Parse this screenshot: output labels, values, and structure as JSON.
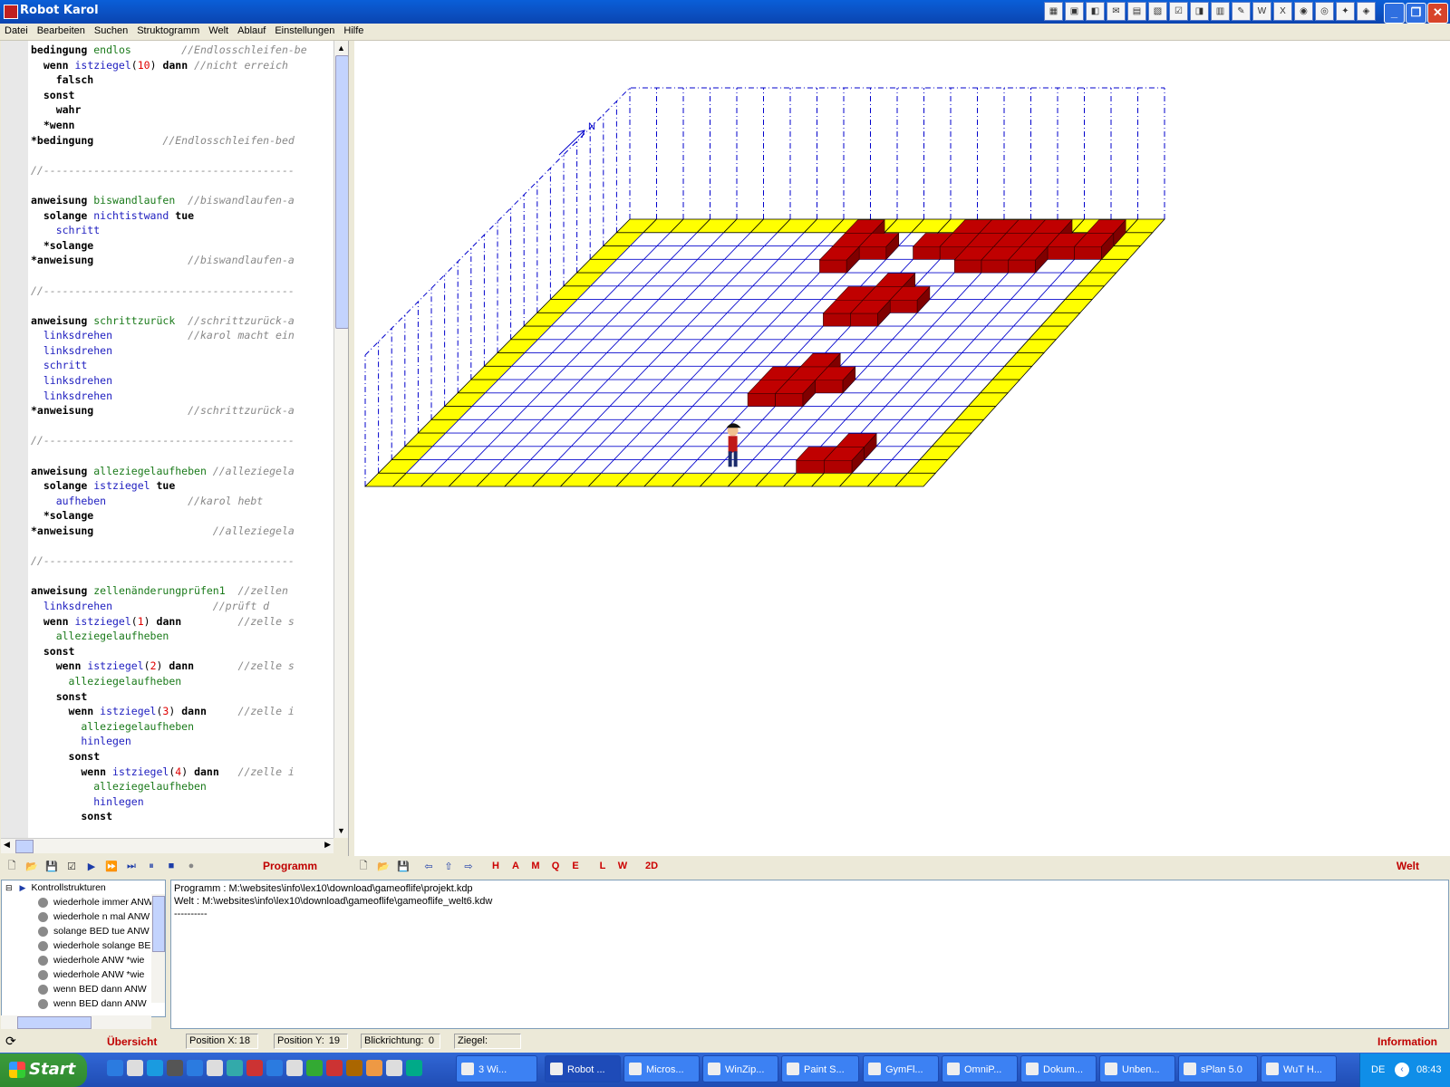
{
  "window": {
    "title": "Robot Karol"
  },
  "menu": [
    "Datei",
    "Bearbeiten",
    "Suchen",
    "Struktogramm",
    "Welt",
    "Ablauf",
    "Einstellungen",
    "Hilfe"
  ],
  "code_lines": [
    [
      {
        "t": "bedingung ",
        "c": "kw"
      },
      {
        "t": "endlos",
        "c": "fn"
      },
      {
        "t": "        //Endlosschleifen-be",
        "c": "cm"
      }
    ],
    [
      {
        "t": "  wenn ",
        "c": "kw"
      },
      {
        "t": "istziegel",
        "c": "bi"
      },
      {
        "t": "(",
        "c": ""
      },
      {
        "t": "10",
        "c": "nm"
      },
      {
        "t": ") ",
        "c": ""
      },
      {
        "t": "dann ",
        "c": "kw"
      },
      {
        "t": "//nicht erreich",
        "c": "cm"
      }
    ],
    [
      {
        "t": "    falsch",
        "c": "kw"
      }
    ],
    [
      {
        "t": "  sonst",
        "c": "kw"
      }
    ],
    [
      {
        "t": "    wahr",
        "c": "kw"
      }
    ],
    [
      {
        "t": "  *wenn",
        "c": "kw"
      }
    ],
    [
      {
        "t": "*bedingung",
        "c": "kw"
      },
      {
        "t": "           //Endlosschleifen-bed",
        "c": "cm"
      }
    ],
    [
      {
        "t": "",
        "c": ""
      }
    ],
    [
      {
        "t": "//----------------------------------------",
        "c": "cm"
      }
    ],
    [
      {
        "t": "",
        "c": ""
      }
    ],
    [
      {
        "t": "anweisung ",
        "c": "kw"
      },
      {
        "t": "biswandlaufen",
        "c": "fn"
      },
      {
        "t": "  //biswandlaufen-a",
        "c": "cm"
      }
    ],
    [
      {
        "t": "  solange ",
        "c": "kw"
      },
      {
        "t": "nichtistwand ",
        "c": "bi"
      },
      {
        "t": "tue",
        "c": "kw"
      }
    ],
    [
      {
        "t": "    schritt",
        "c": "bi"
      }
    ],
    [
      {
        "t": "  *solange",
        "c": "kw"
      }
    ],
    [
      {
        "t": "*anweisung",
        "c": "kw"
      },
      {
        "t": "               //biswandlaufen-a",
        "c": "cm"
      }
    ],
    [
      {
        "t": "",
        "c": ""
      }
    ],
    [
      {
        "t": "//----------------------------------------",
        "c": "cm"
      }
    ],
    [
      {
        "t": "",
        "c": ""
      }
    ],
    [
      {
        "t": "anweisung ",
        "c": "kw"
      },
      {
        "t": "schrittzurück",
        "c": "fn"
      },
      {
        "t": "  //schrittzurück-a",
        "c": "cm"
      }
    ],
    [
      {
        "t": "  linksdrehen",
        "c": "bi"
      },
      {
        "t": "            //karol macht ein",
        "c": "cm"
      }
    ],
    [
      {
        "t": "  linksdrehen",
        "c": "bi"
      }
    ],
    [
      {
        "t": "  schritt",
        "c": "bi"
      }
    ],
    [
      {
        "t": "  linksdrehen",
        "c": "bi"
      }
    ],
    [
      {
        "t": "  linksdrehen",
        "c": "bi"
      }
    ],
    [
      {
        "t": "*anweisung",
        "c": "kw"
      },
      {
        "t": "               //schrittzurück-a",
        "c": "cm"
      }
    ],
    [
      {
        "t": "",
        "c": ""
      }
    ],
    [
      {
        "t": "//----------------------------------------",
        "c": "cm"
      }
    ],
    [
      {
        "t": "",
        "c": ""
      }
    ],
    [
      {
        "t": "anweisung ",
        "c": "kw"
      },
      {
        "t": "alleziegelaufheben",
        "c": "fn"
      },
      {
        "t": " //alleziegela",
        "c": "cm"
      }
    ],
    [
      {
        "t": "  solange ",
        "c": "kw"
      },
      {
        "t": "istziegel ",
        "c": "bi"
      },
      {
        "t": "tue",
        "c": "kw"
      }
    ],
    [
      {
        "t": "    aufheben",
        "c": "bi"
      },
      {
        "t": "             //karol hebt",
        "c": "cm"
      }
    ],
    [
      {
        "t": "  *solange",
        "c": "kw"
      }
    ],
    [
      {
        "t": "*anweisung",
        "c": "kw"
      },
      {
        "t": "                   //alleziegela",
        "c": "cm"
      }
    ],
    [
      {
        "t": "",
        "c": ""
      }
    ],
    [
      {
        "t": "//----------------------------------------",
        "c": "cm"
      }
    ],
    [
      {
        "t": "",
        "c": ""
      }
    ],
    [
      {
        "t": "anweisung ",
        "c": "kw"
      },
      {
        "t": "zellenänderungprüfen1",
        "c": "fn"
      },
      {
        "t": "  //zellen",
        "c": "cm"
      }
    ],
    [
      {
        "t": "  linksdrehen",
        "c": "bi"
      },
      {
        "t": "                //prüft d",
        "c": "cm"
      }
    ],
    [
      {
        "t": "  wenn ",
        "c": "kw"
      },
      {
        "t": "istziegel",
        "c": "bi"
      },
      {
        "t": "(",
        "c": ""
      },
      {
        "t": "1",
        "c": "nm"
      },
      {
        "t": ") ",
        "c": ""
      },
      {
        "t": "dann",
        "c": "kw"
      },
      {
        "t": "         //zelle s",
        "c": "cm"
      }
    ],
    [
      {
        "t": "    alleziegelaufheben",
        "c": "fn"
      }
    ],
    [
      {
        "t": "  sonst",
        "c": "kw"
      }
    ],
    [
      {
        "t": "    wenn ",
        "c": "kw"
      },
      {
        "t": "istziegel",
        "c": "bi"
      },
      {
        "t": "(",
        "c": ""
      },
      {
        "t": "2",
        "c": "nm"
      },
      {
        "t": ") ",
        "c": ""
      },
      {
        "t": "dann",
        "c": "kw"
      },
      {
        "t": "       //zelle s",
        "c": "cm"
      }
    ],
    [
      {
        "t": "      alleziegelaufheben",
        "c": "fn"
      }
    ],
    [
      {
        "t": "    sonst",
        "c": "kw"
      }
    ],
    [
      {
        "t": "      wenn ",
        "c": "kw"
      },
      {
        "t": "istziegel",
        "c": "bi"
      },
      {
        "t": "(",
        "c": ""
      },
      {
        "t": "3",
        "c": "nm"
      },
      {
        "t": ") ",
        "c": ""
      },
      {
        "t": "dann",
        "c": "kw"
      },
      {
        "t": "     //zelle i",
        "c": "cm"
      }
    ],
    [
      {
        "t": "        alleziegelaufheben",
        "c": "fn"
      }
    ],
    [
      {
        "t": "        hinlegen",
        "c": "bi"
      }
    ],
    [
      {
        "t": "      sonst",
        "c": "kw"
      }
    ],
    [
      {
        "t": "        wenn ",
        "c": "kw"
      },
      {
        "t": "istziegel",
        "c": "bi"
      },
      {
        "t": "(",
        "c": ""
      },
      {
        "t": "4",
        "c": "nm"
      },
      {
        "t": ") ",
        "c": ""
      },
      {
        "t": "dann",
        "c": "kw"
      },
      {
        "t": "   //zelle i",
        "c": "cm"
      }
    ],
    [
      {
        "t": "          alleziegelaufheben",
        "c": "fn"
      }
    ],
    [
      {
        "t": "          hinlegen",
        "c": "bi"
      }
    ],
    [
      {
        "t": "        sonst",
        "c": "kw"
      }
    ]
  ],
  "toolbar_left": {
    "label": "Programm"
  },
  "toolbar_right": {
    "label": "Welt",
    "letters": [
      "H",
      "A",
      "M",
      "Q",
      "E",
      "L",
      "W",
      "2D"
    ]
  },
  "world": {
    "compass": "N"
  },
  "tree": {
    "root": "Kontrollstrukturen",
    "items": [
      "wiederhole immer ANW",
      "wiederhole n mal ANW",
      "solange BED tue ANW",
      "wiederhole solange BE",
      "wiederhole ANW *wie",
      "wiederhole ANW *wie",
      "wenn BED dann ANW",
      "wenn BED dann ANW"
    ]
  },
  "info": {
    "lines": [
      "Programm : M:\\websites\\info\\lex10\\download\\gameoflife\\projekt.kdp",
      "Welt : M:\\websites\\info\\lex10\\download\\gameoflife\\gameoflife_welt6.kdw",
      "----------"
    ]
  },
  "status": {
    "overview_label": "Übersicht",
    "pos_x_label": "Position X:",
    "pos_x": "18",
    "pos_y_label": "Position Y:",
    "pos_y": "19",
    "dir_label": "Blickrichtung:",
    "dir": "0",
    "brick_label": "Ziegel:",
    "info_label": "Information"
  },
  "taskbar": {
    "start": "Start",
    "tasks": [
      "3 Wi...",
      "Robot ...",
      "Micros...",
      "WinZip...",
      "Paint S...",
      "GymFl...",
      "OmniP...",
      "Dokum...",
      "Unben...",
      "sPlan 5.0",
      "WuT H..."
    ],
    "lang": "DE",
    "clock": "08:43"
  },
  "colors": {
    "brick": "#c00000",
    "floor_border": "#ffff00",
    "grid": "#0000cc",
    "label_red": "#c00000"
  }
}
